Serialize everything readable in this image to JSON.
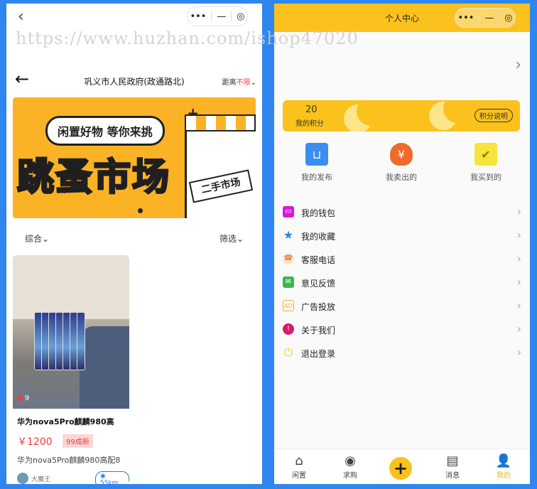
{
  "watermark": "https://www.huzhan.com/ishop47020",
  "left": {
    "topbar": {
      "back": "‹",
      "capsule_more": "•••",
      "capsule_min": "—",
      "capsule_close": "◎"
    },
    "location": {
      "back": "←",
      "title": "巩义市人民政府(政通路北)",
      "dist_label": "距离",
      "dist_value": "不限",
      "dist_chevron": "⌄"
    },
    "banner": {
      "tagline": "闲置好物 等你来挑",
      "headline": "跳蚤市场",
      "sign": "二手市场",
      "plus": "+"
    },
    "filter": {
      "left": "综合⌄",
      "right": "筛选⌄"
    },
    "product": {
      "likes": "9",
      "name": "华为nova5Pro麒麟980高",
      "price": "￥1200",
      "condition": "99成新",
      "desc": "华为nova5Pro麒麟980高配8",
      "seller": "大魔王",
      "distance": "55km",
      "distance_icon": "map-pin-icon"
    }
  },
  "right": {
    "header": {
      "title": "个人中心",
      "capsule_more": "•••",
      "capsule_min": "—",
      "capsule_close": "◎"
    },
    "profile_chevron": "›",
    "points": {
      "value": "20",
      "label": "我的积分",
      "rule": "积分说明"
    },
    "quick": [
      {
        "label": "我的发布",
        "icon": "shopping-bag-icon",
        "glyph": "⊔",
        "color": "#3a8ef0"
      },
      {
        "label": "我卖出的",
        "icon": "money-bag-icon",
        "glyph": "¥",
        "color": "#f06a2a"
      },
      {
        "label": "我买到的",
        "icon": "checkbox-icon",
        "glyph": "✔",
        "color": "#f7e43a"
      }
    ],
    "menu": [
      {
        "label": "我的钱包",
        "icon": "wallet-icon",
        "glyph": "▭",
        "color": "#d61ad8"
      },
      {
        "label": "我的收藏",
        "icon": "star-icon",
        "glyph": "★",
        "color": "#2a88d8"
      },
      {
        "label": "客服电话",
        "icon": "phone-icon",
        "glyph": "☎",
        "color": "#f07a2a"
      },
      {
        "label": "意见反馈",
        "icon": "mail-icon",
        "glyph": "✉",
        "color": "#3ab84a"
      },
      {
        "label": "广告投放",
        "icon": "ad-icon",
        "glyph": "AD",
        "color": "#f5a623"
      },
      {
        "label": "关于我们",
        "icon": "info-icon",
        "glyph": "!",
        "color": "#d8186a"
      },
      {
        "label": "退出登录",
        "icon": "power-icon",
        "glyph": "⏻",
        "color": "#f7d41a"
      }
    ],
    "menu_chevron": "›",
    "tabs": [
      {
        "label": "闲置",
        "icon": "home-icon",
        "glyph": "⌂"
      },
      {
        "label": "求购",
        "icon": "camera-icon",
        "glyph": "◉"
      },
      {
        "label": "消息",
        "icon": "chat-icon",
        "glyph": "▤"
      },
      {
        "label": "我的",
        "icon": "user-icon",
        "glyph": "👤"
      }
    ],
    "fab": "+"
  }
}
